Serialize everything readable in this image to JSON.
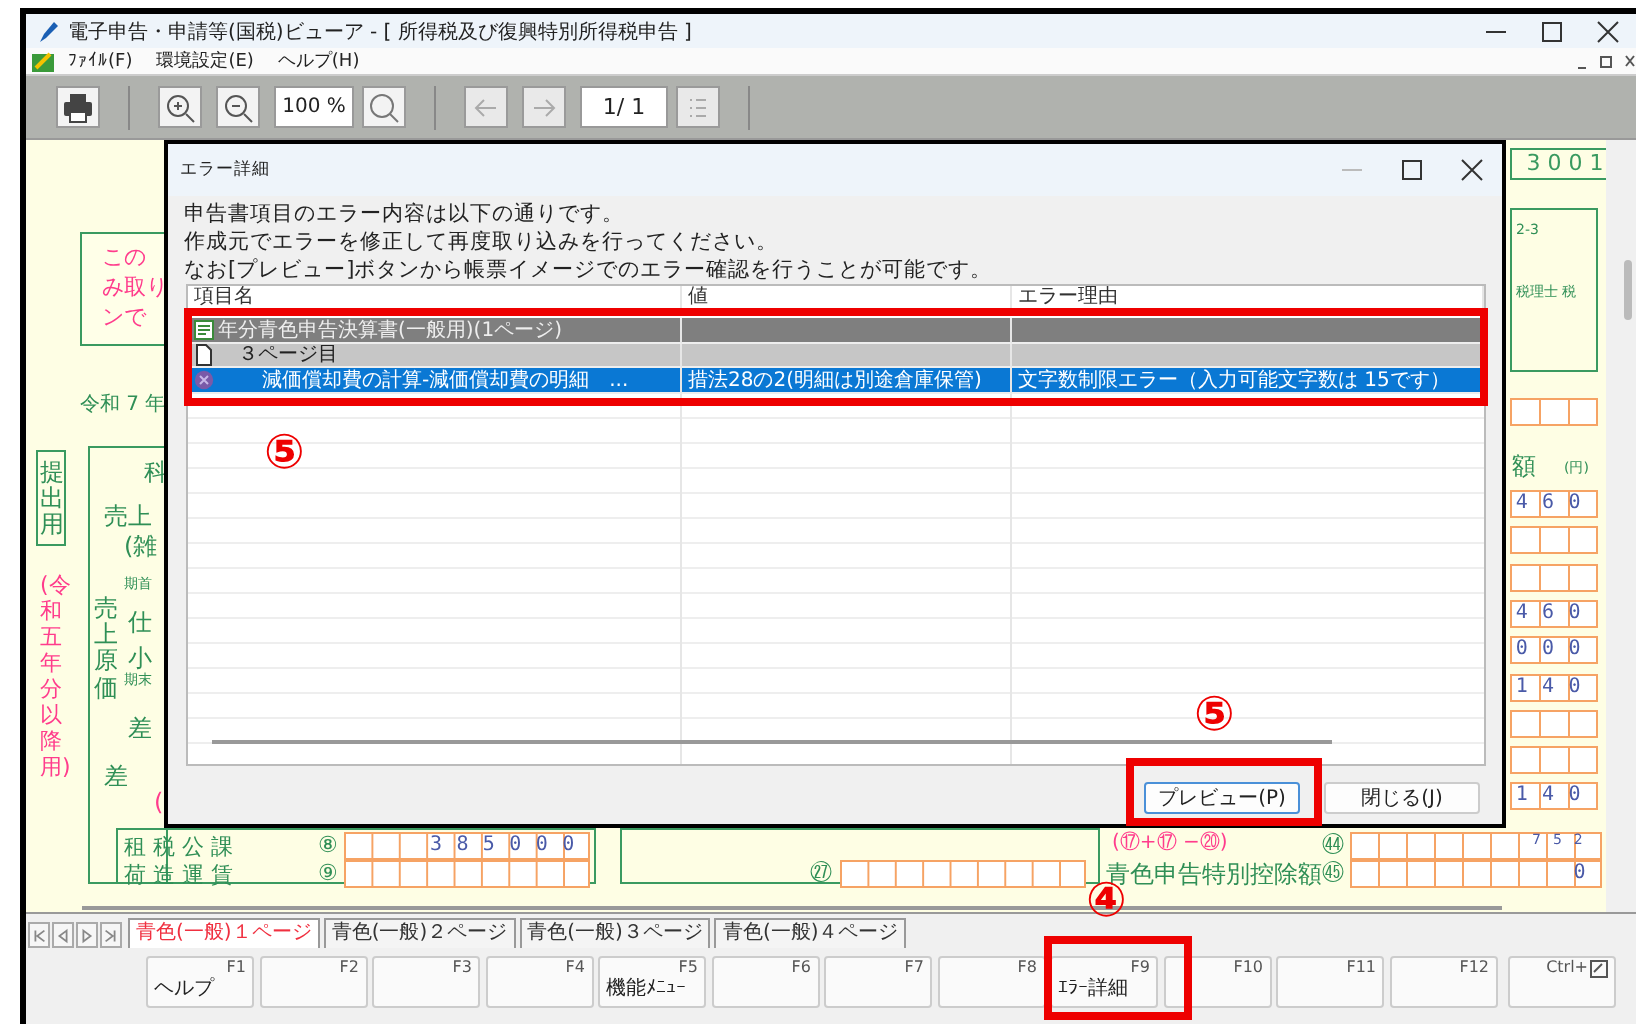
{
  "window": {
    "title": "電子申告・申請等(国税)ビューア - [ 所得税及び復興特別所得税申告 ]"
  },
  "menu": [
    "ﾌｧｲﾙ(F)",
    "環境設定(E)",
    "ヘルプ(H)"
  ],
  "toolbar": {
    "zoom": "100 %",
    "page": "1/ 1"
  },
  "form": {
    "notice_lines": [
      "この",
      "み取り",
      "ンで"
    ],
    "era": "令和 7 年",
    "submission_label": "提出用",
    "year_note": "(令和五年分以降用)",
    "left_labels": [
      {
        "text": "科",
        "kind": "label"
      },
      {
        "text": "売上",
        "kind": "label"
      },
      {
        "text": "(雑",
        "kind": "label"
      },
      {
        "text": "期首",
        "kind": "small"
      },
      {
        "text": "売上原価",
        "kind": "vertical"
      },
      {
        "text": "仕",
        "kind": "label"
      },
      {
        "text": "小",
        "kind": "label"
      },
      {
        "text": "期末",
        "kind": "small"
      },
      {
        "text": "差",
        "kind": "label"
      },
      {
        "text": "差",
        "kind": "label"
      },
      {
        "text": "(",
        "kind": "note"
      }
    ],
    "expense_rows": [
      {
        "label": "租 税 公 課",
        "number": "⑧",
        "amount": "385000"
      },
      {
        "label": "荷 造 運 賃",
        "number": "⑨"
      }
    ],
    "middle_rows": [
      {
        "number": "㉗"
      }
    ],
    "deduction_formula": "(⑰+⑰ −⑳)",
    "deduction_label": "青色申告特別控除額",
    "deduction_rows": [
      {
        "number": "㊹",
        "amount": "752",
        "kind": "small"
      },
      {
        "number": "㊺",
        "amount": "0",
        "kind": "amount"
      }
    ],
    "form_number": "3 0 0 1",
    "address_fragment": "2-3",
    "preparer_fragment": "税理士 税",
    "amount_header": "額",
    "amount_unit": "(円)",
    "right_amounts": [
      {
        "kind": "amount",
        "amount": "460"
      },
      {
        "kind": "blank"
      },
      {
        "kind": "blank"
      },
      {
        "kind": "amount",
        "amount": "460"
      },
      {
        "kind": "amount",
        "amount": "000"
      },
      {
        "kind": "amount",
        "amount": "140"
      },
      {
        "kind": "blank"
      },
      {
        "kind": "blank"
      },
      {
        "kind": "amount",
        "amount": "140"
      }
    ]
  },
  "dialog": {
    "title": "エラー詳細",
    "message_lines": [
      "申告書項目のエラー内容は以下の通りです。",
      "作成元でエラーを修正して再度取り込みを行ってください。",
      "なお[プレビュー]ボタンから帳票イメージでのエラー確認を行うことが可能です。"
    ],
    "columns": [
      "項目名",
      "値",
      "エラー理由"
    ],
    "rows": [
      {
        "kind": "group",
        "name": "年分青色申告決算書(一般用)(1ページ)",
        "selected": false
      },
      {
        "kind": "page",
        "name": "３ページ目",
        "selected": false
      },
      {
        "kind": "error",
        "name": "減価償却費の計算-減価償却費の明細　...",
        "value": "措法28の2(明細は別途倉庫保管)",
        "reason": "文字数制限エラー（入力可能文字数は 15です）",
        "selected": true
      }
    ],
    "buttons": [
      {
        "label": "プレビュー(P)",
        "default": true
      },
      {
        "label": "閉じる(J)",
        "default": false
      }
    ]
  },
  "page_tabs": [
    {
      "label": "青色(一般)１ページ",
      "selected": true
    },
    {
      "label": "青色(一般)２ページ",
      "selected": false
    },
    {
      "label": "青色(一般)３ページ",
      "selected": false
    },
    {
      "label": "青色(一般)４ページ",
      "selected": false
    }
  ],
  "function_keys": [
    {
      "key": "F1",
      "label": "ヘルプ"
    },
    {
      "key": "F2"
    },
    {
      "key": "F3"
    },
    {
      "key": "F4"
    },
    {
      "key": "F5",
      "label": "機能ﾒﾆｭｰ"
    },
    {
      "key": "F6"
    },
    {
      "key": "F7"
    },
    {
      "key": "F8"
    },
    {
      "key": "F9",
      "label": "ｴﾗｰ詳細"
    },
    {
      "key": "F10"
    },
    {
      "key": "F11"
    },
    {
      "key": "F12"
    },
    {
      "key": "Ctrl+",
      "kind": "shortcut"
    }
  ],
  "annotations": [
    "⑤",
    "⑤",
    "④"
  ]
}
